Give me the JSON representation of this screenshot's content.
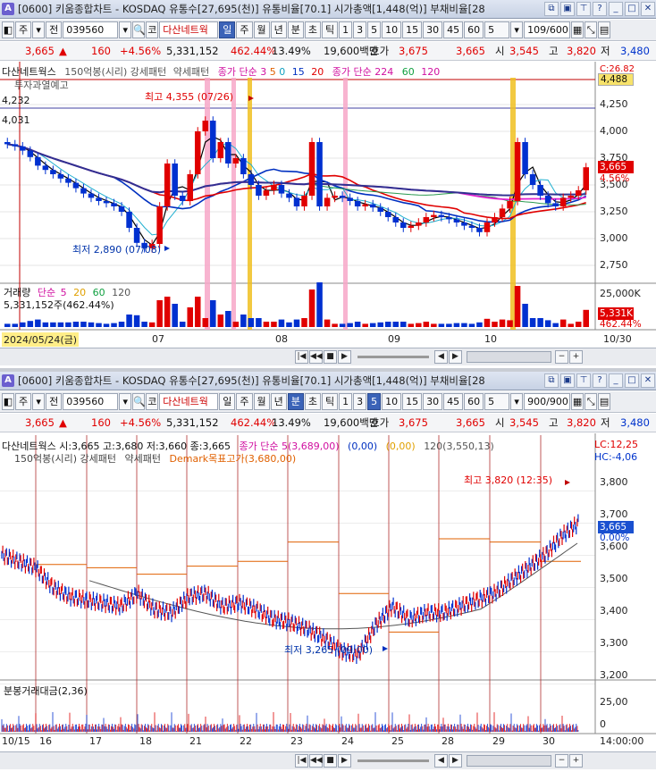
{
  "top": {
    "title": "[0600] 키움종합차트 - KOSDAQ 유통수[27,695(천)] 유통비율[70.1] 시가총액[1,448(억)] 부채비율[28",
    "toolbar": {
      "type": "주",
      "period_mode": "전",
      "code": "039560",
      "name": "다산네트웍",
      "tabs": [
        "일",
        "주",
        "월",
        "년",
        "분",
        "초",
        "틱"
      ],
      "selected_tab": "일",
      "nums": [
        "1",
        "3",
        "5",
        "10",
        "15",
        "30",
        "45",
        "60"
      ],
      "unit": "5",
      "count": "109/600"
    },
    "quote": {
      "price": "3,665",
      "change": "160",
      "change_pct": "+4.56%",
      "volume": "5,331,152",
      "vol_ratio": "462.44%",
      "turnover": "13.49%",
      "amount": "19,600백만",
      "ask_label": "호가",
      "ask": "3,675",
      "bid": "3,665",
      "open_label": "시",
      "open": "3,545",
      "high_label": "고",
      "high": "3,820",
      "low_label": "저",
      "low": "3,480"
    },
    "legend": {
      "stock": "다산네트웍스",
      "pattern": "150억봉(시리) 강세패턴",
      "weak": "약세패턴",
      "ma1": "종가 단순 3",
      "ma1b": "5",
      "ma1c": "0",
      "ma1d": "15",
      "ma1e": "20",
      "ma2": "종가 단순 224",
      "ma2b": "60",
      "ma2c": "120",
      "note": "투자과열예고"
    },
    "hc": "C:26.82",
    "yaxis": [
      "4,250",
      "4,000",
      "3,750",
      "3,500",
      "3,250",
      "3,000",
      "2,750"
    ],
    "price_label": "3,665",
    "pct_label": "4.56%",
    "top_box": "4,488",
    "left_marks": [
      "4,232",
      "4,031"
    ],
    "max_note": "최고 4,355 (07/26)",
    "min_note": "최저 2,890 (07/08)",
    "volume": {
      "title": "거래량",
      "mode": "단순",
      "p1": "5",
      "p2": "20",
      "p3": "60",
      "p4": "120",
      "text": "5,331,152주(462.44%)",
      "axis": "25,000K",
      "box1": "5,331K",
      "box2": "462.44%"
    },
    "xaxis": {
      "start": "2024/05/24(금)",
      "labels": [
        "07",
        "08",
        "09",
        "10"
      ],
      "end": "10/30"
    },
    "chart_data": {
      "type": "candlestick",
      "ylim": [
        2600,
        4500
      ],
      "close_series": [
        3880,
        3860,
        3820,
        3760,
        3680,
        3640,
        3600,
        3560,
        3520,
        3470,
        3420,
        3380,
        3350,
        3330,
        3300,
        3250,
        3100,
        2960,
        2910,
        2950,
        3300,
        3700,
        3400,
        3350,
        3600,
        4000,
        4100,
        3750,
        3900,
        3700,
        3750,
        3600,
        3500,
        3400,
        3450,
        3500,
        3420,
        3380,
        3300,
        3400,
        3900,
        3300,
        3380,
        3400,
        3380,
        3350,
        3300,
        3320,
        3290,
        3250,
        3200,
        3150,
        3100,
        3120,
        3150,
        3200,
        3220,
        3200,
        3180,
        3150,
        3120,
        3100,
        3060,
        3150,
        3200,
        3280,
        3350,
        3900,
        3600,
        3500,
        3400,
        3330,
        3300,
        3380,
        3400,
        3450,
        3665
      ]
    }
  },
  "bottom": {
    "title": "[0600] 키움종합차트 - KOSDAQ 유통수[27,695(천)] 유통비율[70.1] 시가총액[1,448(억)] 부채비율[28",
    "toolbar": {
      "type": "주",
      "period_mode": "전",
      "code": "039560",
      "name": "다산네트웍",
      "tabs": [
        "일",
        "주",
        "월",
        "년",
        "분",
        "초",
        "틱"
      ],
      "selected_tab": "5",
      "nums": [
        "1",
        "3",
        "5",
        "10",
        "15",
        "30",
        "45",
        "60"
      ],
      "unit": "5",
      "count": "900/900"
    },
    "quote": {
      "price": "3,665",
      "change": "160",
      "change_pct": "+4.56%",
      "volume": "5,331,152",
      "vol_ratio": "462.44%",
      "turnover": "13.49%",
      "amount": "19,600백만",
      "ask_label": "호가",
      "ask": "3,675",
      "bid": "3,665",
      "open_label": "시",
      "open": "3,545",
      "high_label": "고",
      "high": "3,820",
      "low_label": "저",
      "low": "3,480"
    },
    "legend": {
      "ohlc": "다산네트웍스 시:3,665 고:3,680 저:3,660 종:3,665",
      "ma": "종가 단순 5(3,689,00)",
      "ma_b": "(0,00)",
      "ma_c": "(0,00)",
      "ma_d": "120(3,550,13)",
      "pattern": "150억봉(시리) 강세패턴",
      "weak": "약세패턴",
      "demark": "Demark목표고가(3,680,00)"
    },
    "lc": "LC:12,25",
    "hc": "HC:-4,06",
    "yaxis": [
      "3,800",
      "3,700",
      "3,600",
      "3,500",
      "3,400",
      "3,300",
      "3,200"
    ],
    "price_label": "3,665",
    "pct_label": "0.00%",
    "max_note": "최고 3,820 (12:35)",
    "min_note": "최저 3,265 (09:00)",
    "volume": {
      "title": "분봉거래대금(2,36)",
      "axis": "25,00",
      "axis2": "0"
    },
    "xaxis": {
      "labels": [
        "10/15",
        "16",
        "17",
        "18",
        "21",
        "22",
        "23",
        "24",
        "25",
        "28",
        "29",
        "30"
      ],
      "end": "14:00:00"
    }
  }
}
